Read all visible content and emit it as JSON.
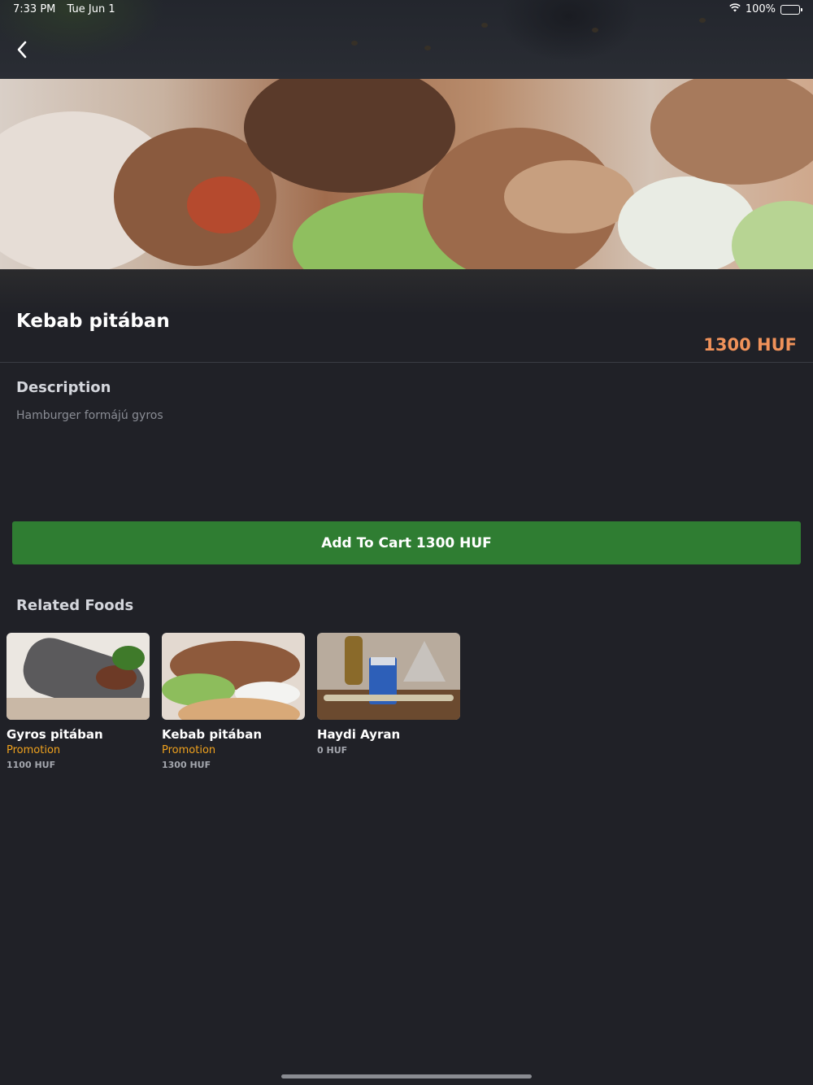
{
  "status_bar": {
    "time": "7:33 PM",
    "date": "Tue Jun 1",
    "battery": "100%"
  },
  "product": {
    "title": "Kebab pitában",
    "price": "1300 HUF",
    "description_heading": "Description",
    "description": "Hamburger formájú gyros"
  },
  "cart_button": {
    "label": "Add To Cart 1300 HUF"
  },
  "related": {
    "heading": "Related Foods",
    "items": [
      {
        "name": "Gyros pitában",
        "promo": "Promotion",
        "price": "1100 HUF"
      },
      {
        "name": "Kebab pitában",
        "promo": "Promotion",
        "price": "1300 HUF"
      },
      {
        "name": "Haydi Ayran",
        "promo": "",
        "price": "0 HUF"
      }
    ]
  },
  "colors": {
    "background": "#202127",
    "accent_price": "#f0925a",
    "cart_button": "#2f7d32",
    "promo": "#f0a21e"
  },
  "icons": {
    "back": "chevron-left-icon",
    "wifi": "wifi-icon",
    "battery": "battery-icon"
  }
}
